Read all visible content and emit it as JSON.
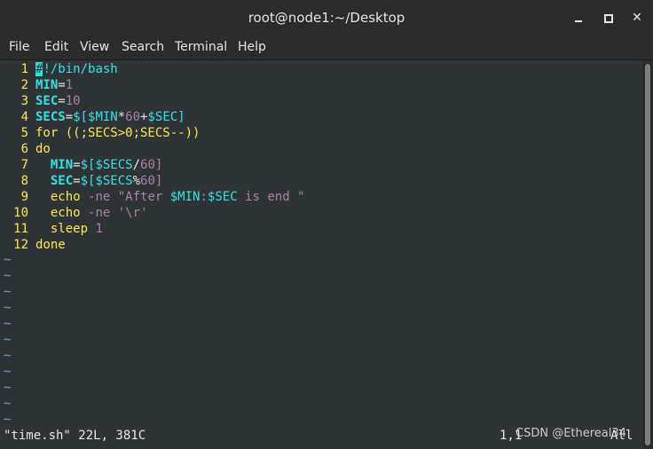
{
  "window": {
    "title": "root@node1:~/Desktop",
    "minimize_icon": "minimize-icon",
    "maximize_icon": "maximize-icon",
    "close_icon": "close-icon",
    "close_glyph": "✕"
  },
  "menu": [
    "File",
    "Edit",
    "View",
    "Search",
    "Terminal",
    "Help"
  ],
  "editor": {
    "line_numbers": [
      "1",
      "2",
      "3",
      "4",
      "5",
      "6",
      "7",
      "8",
      "9",
      "10",
      "11",
      "12"
    ],
    "lines": [
      [
        {
          "t": "#",
          "c": "cursor"
        },
        {
          "t": "!/bin/bash",
          "c": "c-comment"
        }
      ],
      [
        {
          "t": "MIN",
          "c": "c-var"
        },
        {
          "t": "=",
          "c": "c-op"
        },
        {
          "t": "1",
          "c": "c-num"
        }
      ],
      [
        {
          "t": "SEC",
          "c": "c-var"
        },
        {
          "t": "=",
          "c": "c-op"
        },
        {
          "t": "10",
          "c": "c-num"
        }
      ],
      [
        {
          "t": "SECS",
          "c": "c-var"
        },
        {
          "t": "=",
          "c": "c-op"
        },
        {
          "t": "$[$MIN",
          "c": "c-dollar"
        },
        {
          "t": "*",
          "c": "c-op"
        },
        {
          "t": "60",
          "c": "c-num"
        },
        {
          "t": "+",
          "c": "c-op"
        },
        {
          "t": "$SEC]",
          "c": "c-dollar"
        }
      ],
      [
        {
          "t": "for ((;SECS>0;SECS--))",
          "c": "c-kw"
        }
      ],
      [
        {
          "t": "do",
          "c": "c-kw"
        }
      ],
      [
        {
          "t": "  ",
          "c": "c-plain"
        },
        {
          "t": "MIN",
          "c": "c-var"
        },
        {
          "t": "=",
          "c": "c-op"
        },
        {
          "t": "$[$SECS",
          "c": "c-dollar"
        },
        {
          "t": "/",
          "c": "c-op"
        },
        {
          "t": "60]",
          "c": "c-num"
        }
      ],
      [
        {
          "t": "  ",
          "c": "c-plain"
        },
        {
          "t": "SEC",
          "c": "c-var"
        },
        {
          "t": "=",
          "c": "c-op"
        },
        {
          "t": "$[$SECS",
          "c": "c-dollar"
        },
        {
          "t": "%",
          "c": "c-op"
        },
        {
          "t": "60]",
          "c": "c-num"
        }
      ],
      [
        {
          "t": "  echo ",
          "c": "c-kw"
        },
        {
          "t": "-ne ",
          "c": "c-num"
        },
        {
          "t": "\"After ",
          "c": "c-str"
        },
        {
          "t": "$MIN",
          "c": "c-dollar"
        },
        {
          "t": ":",
          "c": "c-str"
        },
        {
          "t": "$SEC",
          "c": "c-dollar"
        },
        {
          "t": " is end \"",
          "c": "c-str"
        }
      ],
      [
        {
          "t": "  echo ",
          "c": "c-kw"
        },
        {
          "t": "-ne ",
          "c": "c-num"
        },
        {
          "t": "'\\r'",
          "c": "c-str"
        }
      ],
      [
        {
          "t": "  sleep ",
          "c": "c-kw"
        },
        {
          "t": "1",
          "c": "c-num"
        }
      ],
      [
        {
          "t": "done",
          "c": "c-kw"
        }
      ]
    ],
    "tilde_count": 11,
    "tilde_char": "~"
  },
  "status": {
    "file_message": "\"time.sh\" 22L, 381C",
    "cursor_position": "1,1",
    "scroll_position": "All"
  },
  "watermark": "CSDN @Ethereal34"
}
